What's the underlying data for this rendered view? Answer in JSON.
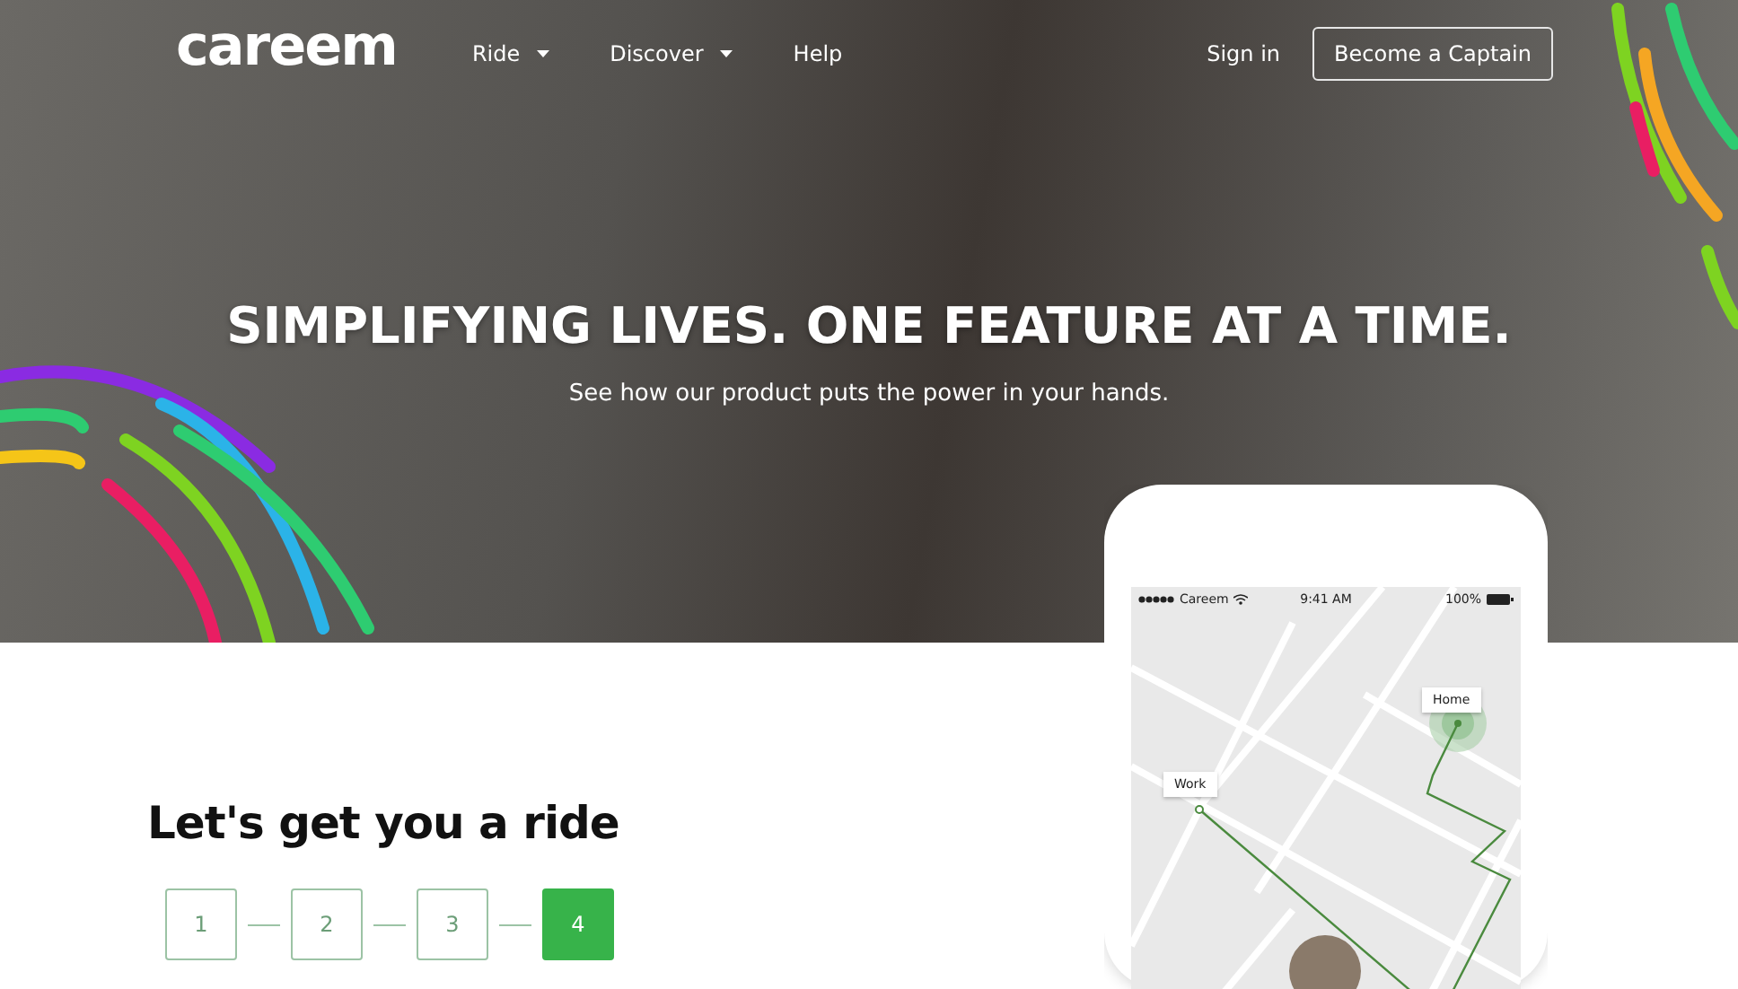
{
  "header": {
    "logo": "careem",
    "nav": [
      {
        "label": "Ride",
        "has_menu": true
      },
      {
        "label": "Discover",
        "has_menu": true
      },
      {
        "label": "Help",
        "has_menu": false
      }
    ],
    "sign_in": "Sign in",
    "cta": "Become a Captain"
  },
  "hero": {
    "title": "SIMPLIFYING LIVES. ONE FEATURE AT A TIME.",
    "subtitle": "See how our product puts the power in your hands."
  },
  "phone": {
    "carrier": "Careem",
    "time": "9:41 AM",
    "battery": "100%",
    "pins": [
      {
        "label": "Home"
      },
      {
        "label": "Work"
      }
    ]
  },
  "section": {
    "title": "Let's get you a ride",
    "steps": [
      {
        "label": "1",
        "selected": false
      },
      {
        "label": "2",
        "selected": false
      },
      {
        "label": "3",
        "selected": false
      },
      {
        "label": "4",
        "selected": true
      }
    ]
  }
}
